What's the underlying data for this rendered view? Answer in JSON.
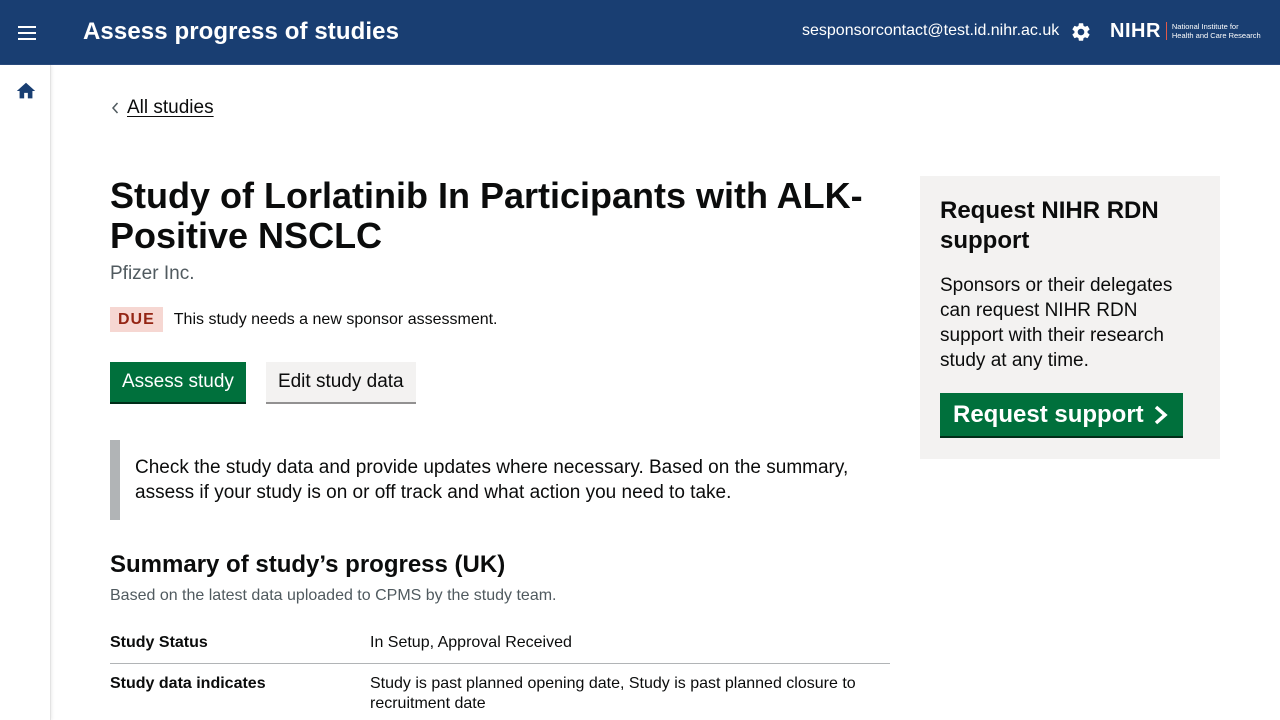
{
  "header": {
    "title": "Assess progress of studies",
    "user_email": "sesponsorcontact@test.id.nihr.ac.uk",
    "logo_mark": "NIHR",
    "logo_line1": "National Institute for",
    "logo_line2": "Health and Care Research"
  },
  "back_link": {
    "label": "All studies"
  },
  "study": {
    "title": "Study of Lorlatinib In Participants with ALK-Positive NSCLC",
    "sponsor": "Pfizer Inc.",
    "status_tag": "DUE",
    "status_text": "This study needs a new sponsor assessment."
  },
  "actions": {
    "assess_label": "Assess study",
    "edit_label": "Edit study data"
  },
  "inset_text": "Check the study data and provide updates where necessary. Based on the summary, assess if your study is on or off track and what action you need to take.",
  "summary": {
    "title": "Summary of study’s progress (UK)",
    "hint": "Based on the latest data uploaded to CPMS by the study team.",
    "rows": [
      {
        "key": "Study Status",
        "value": "In Setup, Approval Received"
      },
      {
        "key": "Study data indicates",
        "value": "Study is past planned opening date, Study is past planned closure to recruitment date"
      }
    ]
  },
  "panel": {
    "title": "Request NIHR RDN support",
    "body": "Sponsors or their delegates can request NIHR RDN support with their research study at any time.",
    "button_label": "Request support"
  },
  "colors": {
    "header_bg": "#193e72",
    "primary_green": "#00703c",
    "due_tag_bg": "#f6d7d2",
    "due_tag_text": "#942514",
    "panel_bg": "#f3f2f1"
  },
  "icons": {
    "menu": "hamburger-menu-icon",
    "settings": "gear-icon",
    "home": "home-icon",
    "back": "chevron-left-icon",
    "request": "chevron-right-icon"
  }
}
